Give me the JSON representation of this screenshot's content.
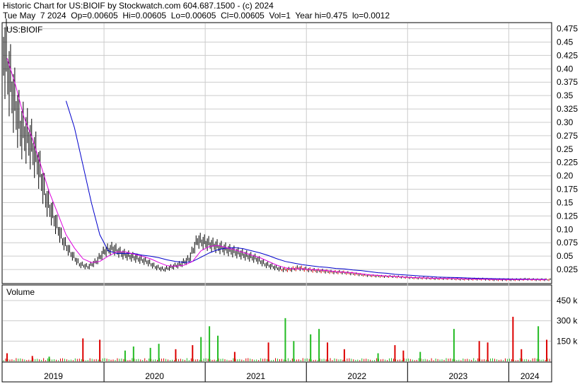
{
  "header": {
    "line1": "Historic Chart for US:BIOIF by Stockwatch.com 604.687.1500 - (c) 2024",
    "line2": "Tue May  7 2024  Op=0.00605  Hi=0.00605  Lo=0.00605  Cl=0.00605  Vol=1  Year hi=0.475  lo=0.0012"
  },
  "colors": {
    "price_bar": "#000000",
    "price_down": "#dd0000",
    "ma_short": "#dd00dd",
    "ma_long": "#0000cc",
    "vol_up": "#22bb22",
    "vol_down": "#dd0000",
    "grid": "#cccccc"
  },
  "chart_data": [
    {
      "type": "line",
      "title": "US:BIOIF",
      "x_years": [
        "2019",
        "2020",
        "2021",
        "2022",
        "2023",
        "2024"
      ],
      "ylim": [
        0,
        0.485
      ],
      "yticks": [
        "0.475",
        "0.45",
        "0.425",
        "0.40",
        "0.375",
        "0.35",
        "0.325",
        "0.30",
        "0.275",
        "0.25",
        "0.225",
        "0.20",
        "0.175",
        "0.15",
        "0.125",
        "0.10",
        "0.075",
        "0.05",
        "0.025"
      ],
      "series": [
        {
          "kind": "price",
          "x": [
            "2019-01",
            "2019-02",
            "2019-03",
            "2019-04",
            "2019-05",
            "2019-06",
            "2019-07",
            "2019-08",
            "2019-09",
            "2019-10",
            "2019-11",
            "2019-12",
            "2020-01",
            "2020-02",
            "2020-03",
            "2020-04",
            "2020-05",
            "2020-06",
            "2020-07",
            "2020-08",
            "2020-09",
            "2020-10",
            "2020-11",
            "2020-12",
            "2021-01",
            "2021-02",
            "2021-03",
            "2021-04",
            "2021-05",
            "2021-06",
            "2021-07",
            "2021-08",
            "2021-09",
            "2021-10",
            "2021-11",
            "2021-12",
            "2022-01",
            "2022-02",
            "2022-03",
            "2022-04",
            "2022-05",
            "2022-06",
            "2022-07",
            "2022-08",
            "2022-09",
            "2022-10",
            "2022-11",
            "2022-12",
            "2023-01",
            "2023-02",
            "2023-03",
            "2023-04",
            "2023-05",
            "2023-06",
            "2023-07",
            "2023-08",
            "2023-09",
            "2023-10",
            "2023-11",
            "2023-12",
            "2024-01",
            "2024-02",
            "2024-03",
            "2024-04",
            "2024-05"
          ],
          "y": [
            0.44,
            0.36,
            0.29,
            0.27,
            0.23,
            0.16,
            0.12,
            0.08,
            0.055,
            0.035,
            0.03,
            0.04,
            0.06,
            0.065,
            0.055,
            0.05,
            0.045,
            0.04,
            0.03,
            0.025,
            0.03,
            0.035,
            0.045,
            0.08,
            0.075,
            0.07,
            0.065,
            0.06,
            0.055,
            0.05,
            0.045,
            0.035,
            0.03,
            0.025,
            0.025,
            0.028,
            0.025,
            0.023,
            0.022,
            0.02,
            0.02,
            0.018,
            0.016,
            0.014,
            0.013,
            0.012,
            0.012,
            0.011,
            0.01,
            0.009,
            0.009,
            0.008,
            0.008,
            0.008,
            0.007,
            0.007,
            0.007,
            0.007,
            0.006,
            0.006,
            0.006,
            0.006,
            0.007,
            0.006,
            0.006
          ]
        },
        {
          "kind": "ma_short",
          "y": [
            0.42,
            0.37,
            0.31,
            0.27,
            0.22,
            0.17,
            0.13,
            0.09,
            0.065,
            0.045,
            0.038,
            0.04,
            0.05,
            0.058,
            0.058,
            0.054,
            0.05,
            0.045,
            0.038,
            0.032,
            0.031,
            0.033,
            0.04,
            0.06,
            0.068,
            0.07,
            0.066,
            0.062,
            0.057,
            0.052,
            0.047,
            0.04,
            0.033,
            0.028,
            0.026,
            0.026,
            0.025,
            0.024,
            0.023,
            0.021,
            0.02,
            0.019,
            0.017,
            0.015,
            0.014,
            0.013,
            0.012,
            0.011,
            0.01,
            0.0095,
            0.009,
            0.0085,
            0.0082,
            0.008,
            0.0075,
            0.0072,
            0.007,
            0.0068,
            0.0065,
            0.0063,
            0.0062,
            0.0061,
            0.0062,
            0.0061,
            0.006
          ]
        },
        {
          "kind": "ma_long",
          "y": [
            null,
            null,
            null,
            null,
            null,
            null,
            null,
            0.34,
            0.29,
            0.22,
            0.15,
            0.09,
            0.06,
            0.055,
            0.055,
            0.055,
            0.052,
            0.05,
            0.047,
            0.043,
            0.04,
            0.038,
            0.04,
            0.048,
            0.056,
            0.062,
            0.065,
            0.066,
            0.064,
            0.06,
            0.056,
            0.051,
            0.045,
            0.04,
            0.037,
            0.034,
            0.032,
            0.03,
            0.029,
            0.027,
            0.026,
            0.024,
            0.023,
            0.021,
            0.019,
            0.018,
            0.016,
            0.015,
            0.014,
            0.013,
            0.012,
            0.011,
            0.0105,
            0.01,
            0.0095,
            0.009,
            0.0085,
            0.008,
            0.0078,
            0.0075,
            0.0072,
            0.007,
            0.0068,
            0.0066,
            0.0065
          ]
        }
      ]
    },
    {
      "type": "bar",
      "title": "Volume",
      "yticks": [
        "450 k",
        "300 k",
        "150 k"
      ],
      "ylim": [
        0,
        560
      ],
      "months": 65,
      "spikes": [
        {
          "m": 0,
          "v": 60,
          "up": false
        },
        {
          "m": 3,
          "v": 40,
          "up": false
        },
        {
          "m": 5,
          "v": 35,
          "up": true
        },
        {
          "m": 9,
          "v": 170,
          "up": false
        },
        {
          "m": 11,
          "v": 160,
          "up": false
        },
        {
          "m": 14,
          "v": 80,
          "up": true
        },
        {
          "m": 15,
          "v": 110,
          "up": true
        },
        {
          "m": 17,
          "v": 100,
          "up": true
        },
        {
          "m": 18,
          "v": 130,
          "up": true
        },
        {
          "m": 20,
          "v": 90,
          "up": false
        },
        {
          "m": 22,
          "v": 120,
          "up": false
        },
        {
          "m": 23,
          "v": 180,
          "up": true
        },
        {
          "m": 24,
          "v": 260,
          "up": true
        },
        {
          "m": 25,
          "v": 190,
          "up": true
        },
        {
          "m": 27,
          "v": 70,
          "up": false
        },
        {
          "m": 31,
          "v": 140,
          "up": false
        },
        {
          "m": 33,
          "v": 320,
          "up": true
        },
        {
          "m": 34,
          "v": 150,
          "up": true
        },
        {
          "m": 36,
          "v": 200,
          "up": true
        },
        {
          "m": 37,
          "v": 240,
          "up": true
        },
        {
          "m": 38,
          "v": 140,
          "up": false
        },
        {
          "m": 40,
          "v": 90,
          "up": false
        },
        {
          "m": 44,
          "v": 60,
          "up": true
        },
        {
          "m": 46,
          "v": 120,
          "up": false
        },
        {
          "m": 47,
          "v": 80,
          "up": false
        },
        {
          "m": 49,
          "v": 70,
          "up": true
        },
        {
          "m": 53,
          "v": 240,
          "up": true
        },
        {
          "m": 56,
          "v": 150,
          "up": false
        },
        {
          "m": 57,
          "v": 140,
          "up": false
        },
        {
          "m": 60,
          "v": 330,
          "up": false
        },
        {
          "m": 61,
          "v": 90,
          "up": false
        },
        {
          "m": 63,
          "v": 260,
          "up": true
        },
        {
          "m": 64,
          "v": 160,
          "up": false
        }
      ]
    }
  ]
}
